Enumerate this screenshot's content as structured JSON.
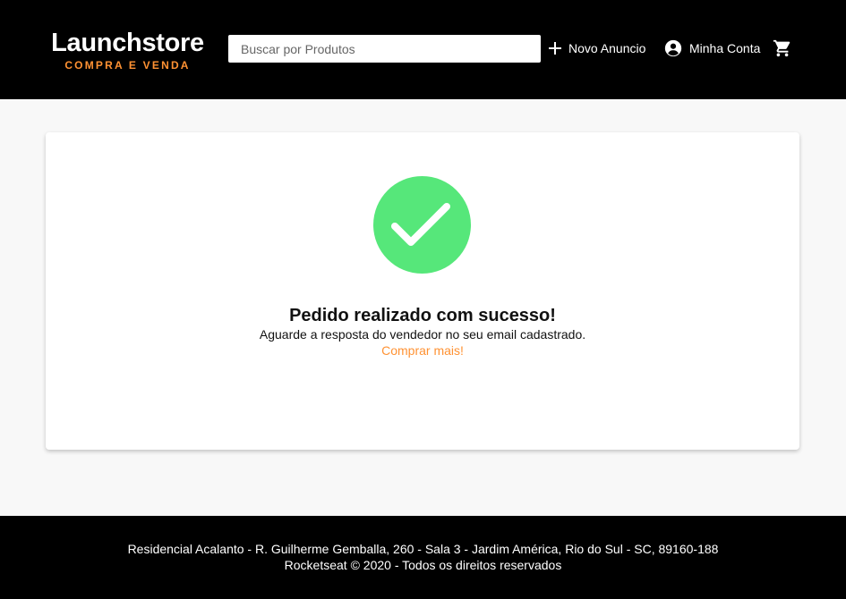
{
  "header": {
    "brand": {
      "title": "Launchstore",
      "subtitle": "COMPRA E VENDA"
    },
    "search": {
      "placeholder": "Buscar por Produtos",
      "value": ""
    },
    "nav": {
      "new_ad": {
        "label": "Novo Anuncio",
        "icon": "plus-icon"
      },
      "account": {
        "label": "Minha Conta",
        "icon": "account-circle-icon"
      },
      "cart": {
        "icon": "shopping-cart-icon"
      }
    }
  },
  "message": {
    "icon": "check-circle-icon",
    "title": "Pedido realizado com sucesso!",
    "text": "Aguarde a resposta do vendedor no seu email cadastrado.",
    "link_label": "Comprar mais!"
  },
  "footer": {
    "address": "Residencial Acalanto - R. Guilherme Gemballa, 260 - Sala 3 - Jardim América, Rio do Sul - SC, 89160-188",
    "copyright": "Rocketseat © 2020 - Todos os direitos reservados"
  },
  "colors": {
    "header_bg": "#000000",
    "accent": "#ff9233",
    "success": "#56e77a",
    "page_bg": "#f8f8f8"
  }
}
